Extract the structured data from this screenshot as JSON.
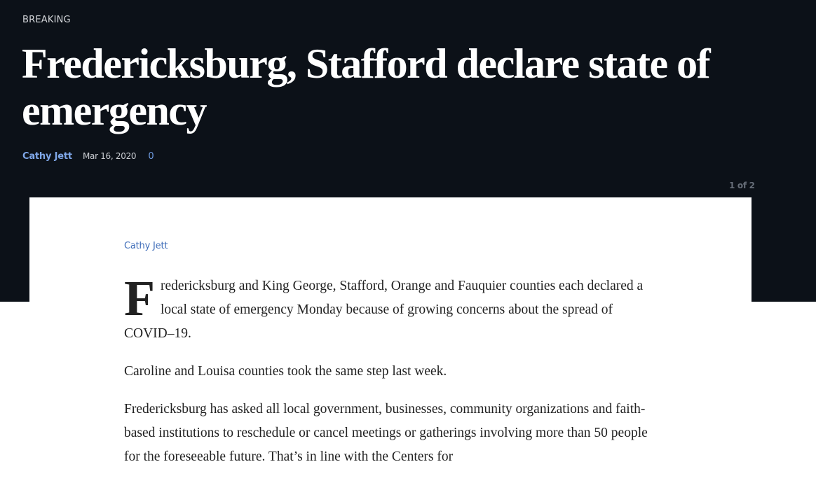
{
  "header": {
    "kicker": "BREAKING",
    "headline": "Fredericksburg, Stafford declare state of emergency",
    "author": "Cathy Jett",
    "date": "Mar 16, 2020",
    "comment_count": "0"
  },
  "gallery": {
    "pager": "1 of 2",
    "photo_credit": "Cathy Jett"
  },
  "article": {
    "dropcap": "F",
    "p1": "redericksburg and King George, Stafford, Orange and Fauquier counties each declared a local state of emergency Monday because of growing concerns about the spread of COVID–19.",
    "p2": "Caroline and Louisa counties took the same step last week.",
    "p3": "Fredericksburg has asked all local government, businesses, community organizations and faith-based institutions to reschedule or cancel meetings or gatherings involving more than 50 people for the foreseeable future. That’s in line with the Centers for"
  },
  "colors": {
    "header_background": "#0c1118",
    "author_link": "#7fa7e8",
    "credit_link": "#3e6cb8"
  }
}
